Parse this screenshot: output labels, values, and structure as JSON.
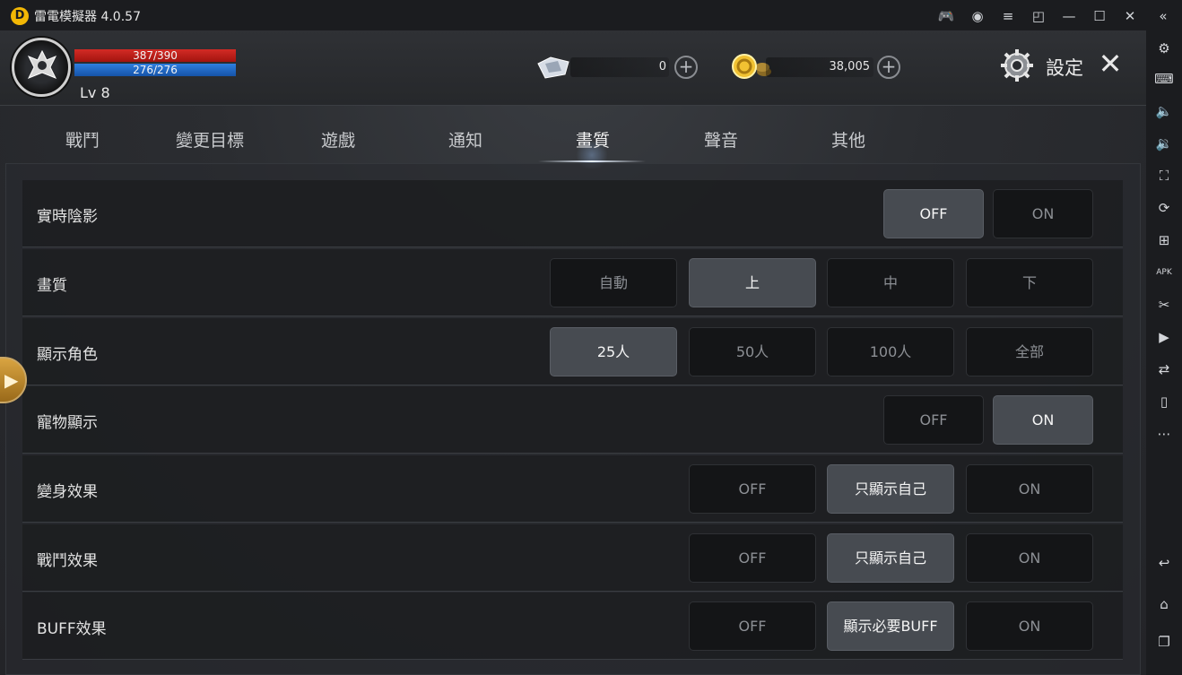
{
  "window": {
    "title": "雷電模擬器 4.0.57"
  },
  "titlebar_icons": [
    "gamepad-icon",
    "account-icon",
    "menu-icon",
    "popout-icon",
    "minimize-icon",
    "maximize-icon",
    "close-icon",
    "collapse-icon"
  ],
  "sidebar_icons": [
    "settings-icon",
    "keyboard-icon",
    "volume-up-icon",
    "volume-down-icon",
    "screenshot-icon",
    "record-icon",
    "add-app-icon",
    "apk-icon",
    "scissors-icon",
    "video-icon",
    "sync-icon",
    "shake-icon",
    "more-icon",
    "back-icon",
    "home-icon",
    "recent-apps-icon"
  ],
  "hud": {
    "hp": "387/390",
    "mp": "276/276",
    "level": "Lv 8",
    "diamonds": "0",
    "gold": "38,005",
    "settings_title": "設定"
  },
  "tabs": [
    {
      "label": "戰鬥",
      "active": false
    },
    {
      "label": "變更目標",
      "active": false
    },
    {
      "label": "遊戲",
      "active": false
    },
    {
      "label": "通知",
      "active": false
    },
    {
      "label": "畫質",
      "active": true
    },
    {
      "label": "聲音",
      "active": false
    },
    {
      "label": "其他",
      "active": false
    }
  ],
  "settings": [
    {
      "label": "實時陰影",
      "options": [
        "OFF",
        "ON"
      ],
      "selected": 0
    },
    {
      "label": "畫質",
      "options": [
        "自動",
        "上",
        "中",
        "下"
      ],
      "selected": 1
    },
    {
      "label": "顯示角色",
      "options": [
        "25人",
        "50人",
        "100人",
        "全部"
      ],
      "selected": 0
    },
    {
      "label": "寵物顯示",
      "options": [
        "OFF",
        "ON"
      ],
      "selected": 1
    },
    {
      "label": "變身效果",
      "options": [
        "OFF",
        "只顯示自己",
        "ON"
      ],
      "selected": 1
    },
    {
      "label": "戰鬥效果",
      "options": [
        "OFF",
        "只顯示自己",
        "ON"
      ],
      "selected": 1
    },
    {
      "label": "BUFF效果",
      "options": [
        "OFF",
        "顯示必要BUFF",
        "ON"
      ],
      "selected": 1
    }
  ]
}
